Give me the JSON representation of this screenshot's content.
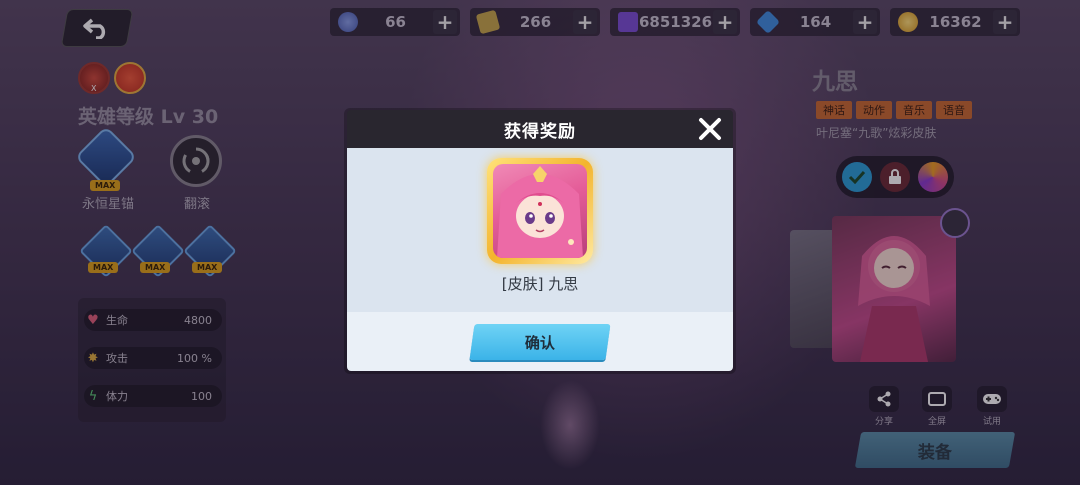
{
  "resources": [
    {
      "name": "token",
      "icon": "swirl-coin-icon",
      "value": "66"
    },
    {
      "name": "ticket",
      "icon": "ticket-icon",
      "value": "266"
    },
    {
      "name": "crystal",
      "icon": "purple-cube-icon",
      "value": "6851326"
    },
    {
      "name": "gem",
      "icon": "blue-gem-icon",
      "value": "164"
    },
    {
      "name": "gold",
      "icon": "gold-coin-icon",
      "value": "16362"
    }
  ],
  "hero": {
    "level_label": "英雄等级 Lv 30",
    "badge_x": "X",
    "skills": [
      {
        "label": "永恒星锚",
        "max": "MAX"
      },
      {
        "label": "翻滚"
      }
    ],
    "small_skills_max": [
      "MAX",
      "MAX",
      "MAX"
    ],
    "stats": [
      {
        "icon": "heart-icon",
        "name": "生命",
        "value": "4800"
      },
      {
        "icon": "burst-icon",
        "name": "攻击",
        "value": "100 %"
      },
      {
        "icon": "lightning-icon",
        "name": "体力",
        "value": "100"
      }
    ]
  },
  "skin_panel": {
    "name": "九思",
    "tags": [
      "神话",
      "动作",
      "音乐",
      "语音"
    ],
    "description": "叶尼塞“九歌”炫彩皮肤",
    "tools": [
      {
        "icon": "share-icon",
        "label": "分享"
      },
      {
        "icon": "fullscreen-icon",
        "label": "全屏"
      },
      {
        "icon": "gamepad-icon",
        "label": "试用"
      }
    ],
    "equip_label": "装备"
  },
  "modal": {
    "title": "获得奖励",
    "reward_label": "[皮肤] 九思",
    "confirm_label": "确认"
  },
  "colors": {
    "modal_body": "#dbe4ef",
    "confirm_button": "#4fc1ee",
    "tag_orange": "#c96a30"
  }
}
